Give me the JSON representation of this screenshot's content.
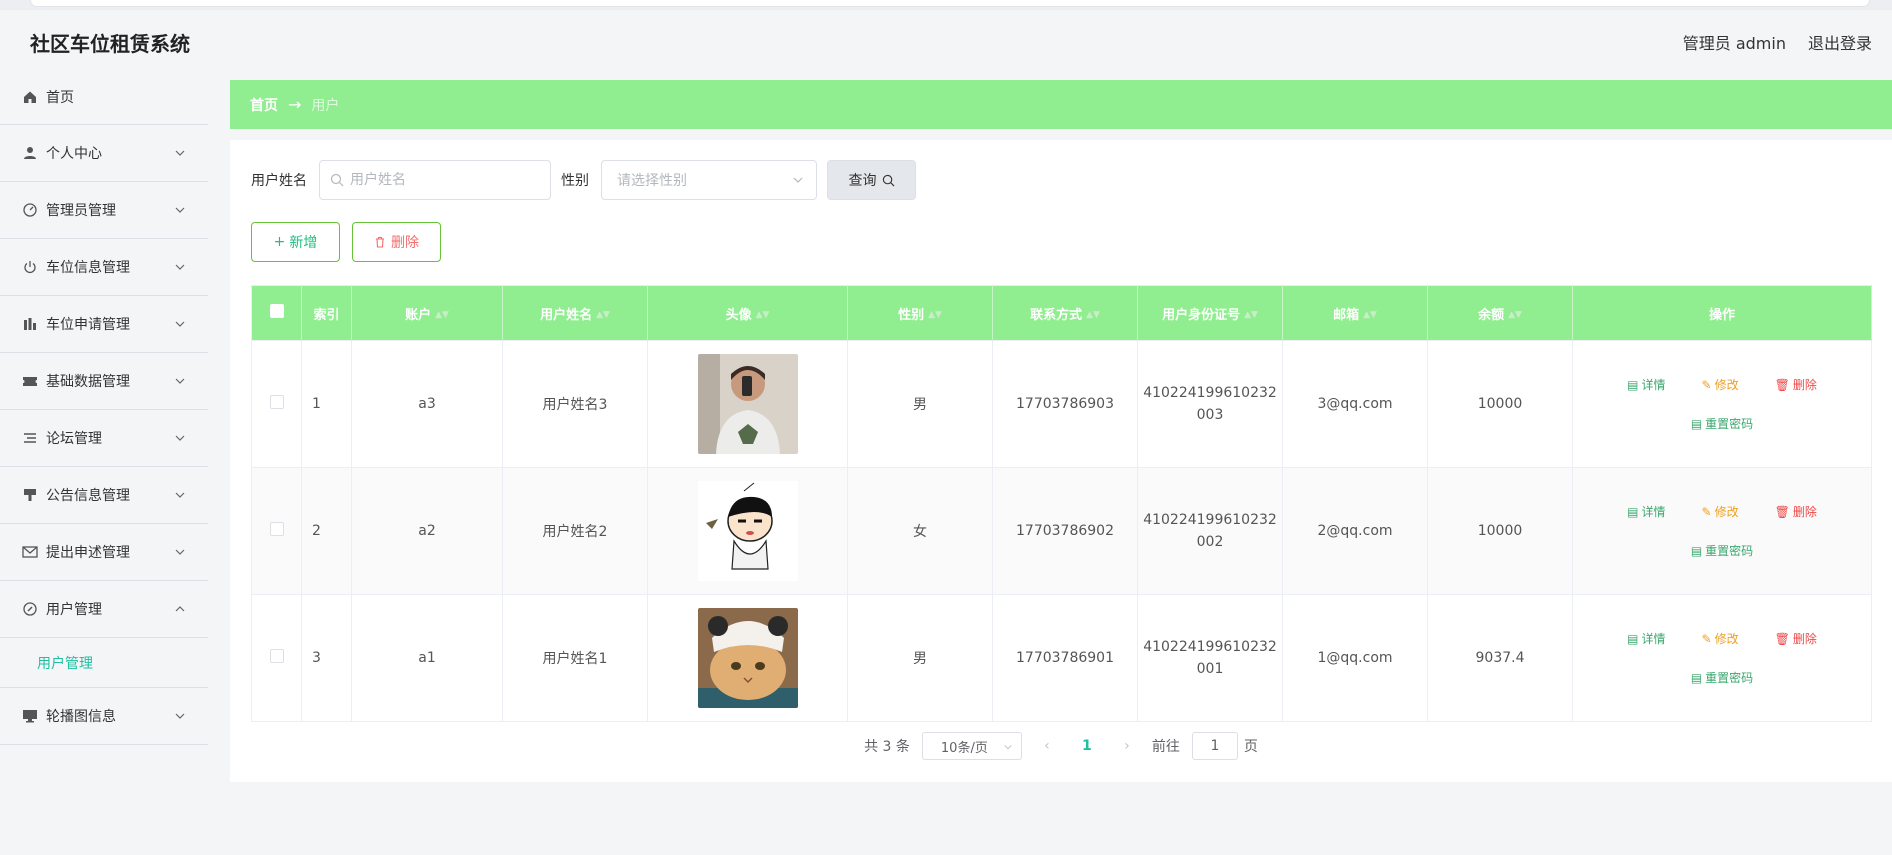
{
  "app": {
    "title": "社区车位租赁系统"
  },
  "header": {
    "user_label": "管理员 admin",
    "logout_label": "退出登录"
  },
  "sidebar": {
    "items": [
      {
        "label": "首页",
        "icon": "home-icon"
      },
      {
        "label": "个人中心",
        "icon": "user-icon"
      },
      {
        "label": "管理员管理",
        "icon": "gauge-icon"
      },
      {
        "label": "车位信息管理",
        "icon": "power-icon"
      },
      {
        "label": "车位申请管理",
        "icon": "chart-icon"
      },
      {
        "label": "基础数据管理",
        "icon": "ticket-icon"
      },
      {
        "label": "论坛管理",
        "icon": "list-icon"
      },
      {
        "label": "公告信息管理",
        "icon": "brush-icon"
      },
      {
        "label": "提出申述管理",
        "icon": "mail-icon"
      },
      {
        "label": "用户管理",
        "icon": "compass-icon"
      },
      {
        "label": "轮播图信息",
        "icon": "monitor-icon"
      }
    ],
    "active_sub": "用户管理"
  },
  "breadcrumb": {
    "home": "首页",
    "current": "用户"
  },
  "search": {
    "name_label": "用户姓名",
    "name_placeholder": "用户姓名",
    "gender_label": "性别",
    "gender_placeholder": "请选择性别",
    "query_label": "查询"
  },
  "actions": {
    "add_label": "新增",
    "delete_label": "删除"
  },
  "table": {
    "headers": [
      "索引",
      "账户",
      "用户姓名",
      "头像",
      "性别",
      "联系方式",
      "用户身份证号",
      "邮箱",
      "余额",
      "操作"
    ],
    "rows": [
      {
        "index": "1",
        "account": "a3",
        "name": "用户姓名3",
        "gender": "男",
        "phone": "17703786903",
        "id_line1": "410224199610232",
        "id_line2": "003",
        "email": "3@qq.com",
        "balance": "10000"
      },
      {
        "index": "2",
        "account": "a2",
        "name": "用户姓名2",
        "gender": "女",
        "phone": "17703786902",
        "id_line1": "410224199610232",
        "id_line2": "002",
        "email": "2@qq.com",
        "balance": "10000"
      },
      {
        "index": "3",
        "account": "a1",
        "name": "用户姓名1",
        "gender": "男",
        "phone": "17703786901",
        "id_line1": "410224199610232",
        "id_line2": "001",
        "email": "1@qq.com",
        "balance": "9037.4"
      }
    ],
    "ops": {
      "view": "详情",
      "edit": "修改",
      "del": "删除",
      "reset": "重置密码"
    }
  },
  "pager": {
    "total": "共 3 条",
    "page_size": "10条/页",
    "current": "1",
    "goto_label": "前往",
    "goto_value": "1",
    "page_suffix": "页"
  },
  "colors": {
    "accent_green": "#90ee90",
    "teal": "#1fbf9f"
  }
}
